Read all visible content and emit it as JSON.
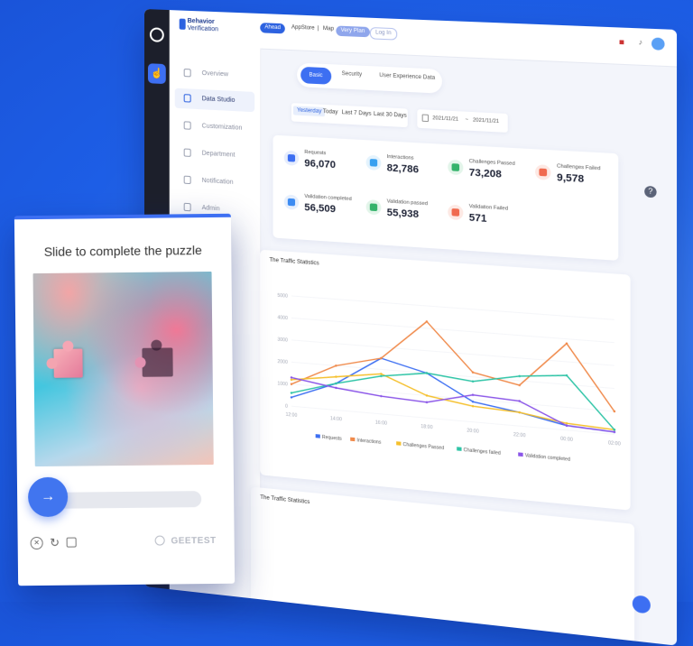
{
  "topbar": {
    "brand_line1": "Behavior",
    "brand_line2": "Verification",
    "badge": "Ahead",
    "app_store": "AppStore",
    "separator": "|",
    "map": "Map",
    "btn_primary": "Very Plan",
    "btn_secondary": "Log In"
  },
  "sidebar": {
    "items": [
      {
        "label": "Overview"
      },
      {
        "label": "Data Studio"
      },
      {
        "label": "Customization"
      },
      {
        "label": "Department"
      },
      {
        "label": "Notification"
      },
      {
        "label": "Admin"
      }
    ]
  },
  "tabs": [
    "Basic",
    "Security",
    "User Experience Data"
  ],
  "date_filters": [
    "Yesterday",
    "Today",
    "Last 7 Days",
    "Last 30 Days"
  ],
  "date_range": {
    "start": "2021/11/21",
    "end": "2021/11/21",
    "separator": "~"
  },
  "stats": [
    {
      "label": "Requests",
      "value": "96,070",
      "color": "#3d6ff2"
    },
    {
      "label": "Interactions",
      "value": "82,786",
      "color": "#37a0f0"
    },
    {
      "label": "Challenges Passed",
      "value": "73,208",
      "color": "#35b36b"
    },
    {
      "label": "Challenges Failed",
      "value": "9,578",
      "color": "#f06a4f"
    },
    {
      "label": "Validation completed",
      "value": "56,509",
      "color": "#3d8cf2"
    },
    {
      "label": "Validation passed",
      "value": "55,938",
      "color": "#35b36b"
    },
    {
      "label": "Validation Failed",
      "value": "571",
      "color": "#f06a4f"
    }
  ],
  "chart_card_title": "The Traffic Statistics",
  "chart_card2_title": "The Traffic Statistics",
  "chart_data": {
    "type": "line",
    "title": "The Traffic Statistics",
    "categories": [
      "12:00",
      "14:00",
      "16:00",
      "18:00",
      "20:00",
      "22:00",
      "00:00",
      "02:00"
    ],
    "ylim": [
      0,
      5000
    ],
    "yticks": [
      "5000",
      "4000",
      "3000",
      "2000",
      "1000",
      "0"
    ],
    "grid": true,
    "legend": "bottom",
    "series": [
      {
        "name": "Requests",
        "color": "#3d6ff2",
        "values": [
          400,
          1200,
          2500,
          2000,
          900,
          600,
          200,
          100
        ]
      },
      {
        "name": "Interactions",
        "color": "#f08a4b",
        "values": [
          1000,
          2000,
          2500,
          4300,
          2200,
          1800,
          3800,
          1000
        ]
      },
      {
        "name": "Challenges Passed",
        "color": "#f5c02d",
        "values": [
          1200,
          1500,
          1800,
          1000,
          700,
          600,
          300,
          200
        ]
      },
      {
        "name": "Challenges failed",
        "color": "#2ec4a6",
        "values": [
          600,
          1200,
          1700,
          2000,
          1800,
          2200,
          2400,
          200
        ]
      },
      {
        "name": "Validation completed",
        "color": "#8a55e8",
        "values": [
          1300,
          1000,
          800,
          700,
          1200,
          1100,
          200,
          100
        ]
      }
    ]
  },
  "captcha": {
    "title": "Slide to complete the puzzle",
    "slider_arrow": "→",
    "brand": "GEETEST"
  }
}
